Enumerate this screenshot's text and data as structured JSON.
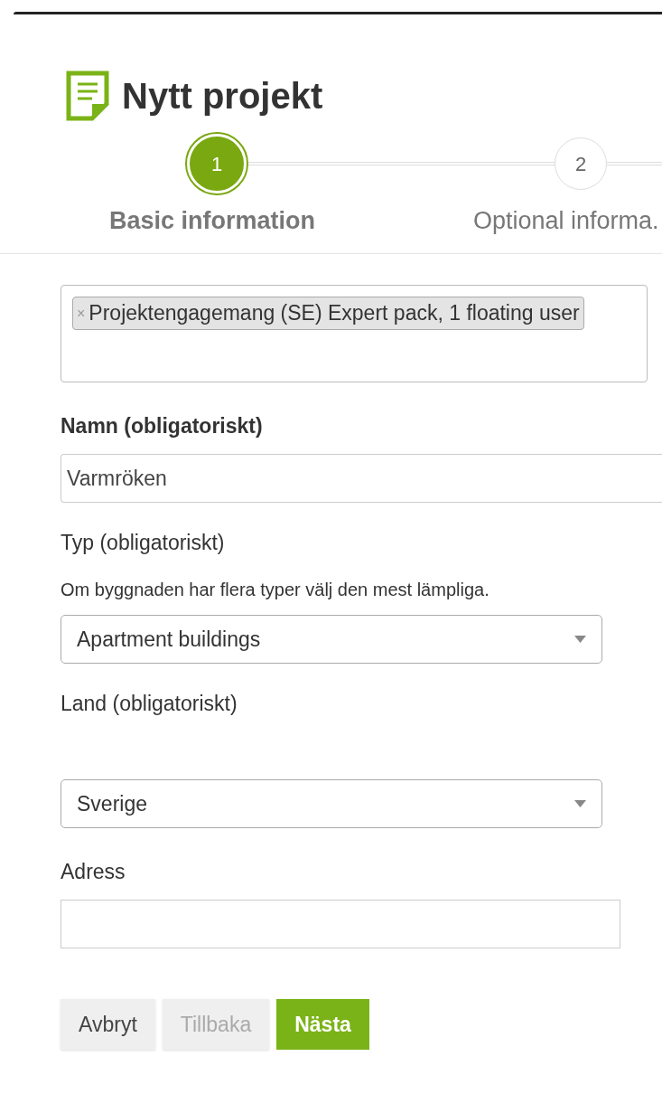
{
  "header": {
    "title": "Nytt projekt"
  },
  "steps": [
    {
      "number": "1",
      "label": "Basic information",
      "selected": true
    },
    {
      "number": "2",
      "label": "Optional informa.",
      "selected": false
    }
  ],
  "license": {
    "tags": [
      {
        "remove": "×",
        "text": "Projektengagemang (SE) Expert pack, 1 floating user"
      }
    ]
  },
  "fields": [
    {
      "kind": "input",
      "label": "Namn (obligatoriskt)",
      "bold": true,
      "value": "Varmröken",
      "wide": true
    },
    {
      "kind": "select",
      "label": "Typ (obligatoriskt)",
      "bold": false,
      "hint": "Om byggnaden har flera typer välj den mest lämpliga.",
      "value": "Apartment buildings",
      "wide": false
    },
    {
      "kind": "select",
      "label": "Land (obligatoriskt)",
      "bold": false,
      "gap": true,
      "value": "Sverige",
      "wide": false
    },
    {
      "kind": "input",
      "label": "Adress",
      "bold": false,
      "wide": false
    }
  ],
  "buttons": [
    {
      "label": "Avbryt",
      "kind": "default",
      "disabled": false
    },
    {
      "label": "Tillbaka",
      "kind": "default",
      "disabled": true
    },
    {
      "label": "Nästa",
      "kind": "primary",
      "disabled": false
    }
  ]
}
